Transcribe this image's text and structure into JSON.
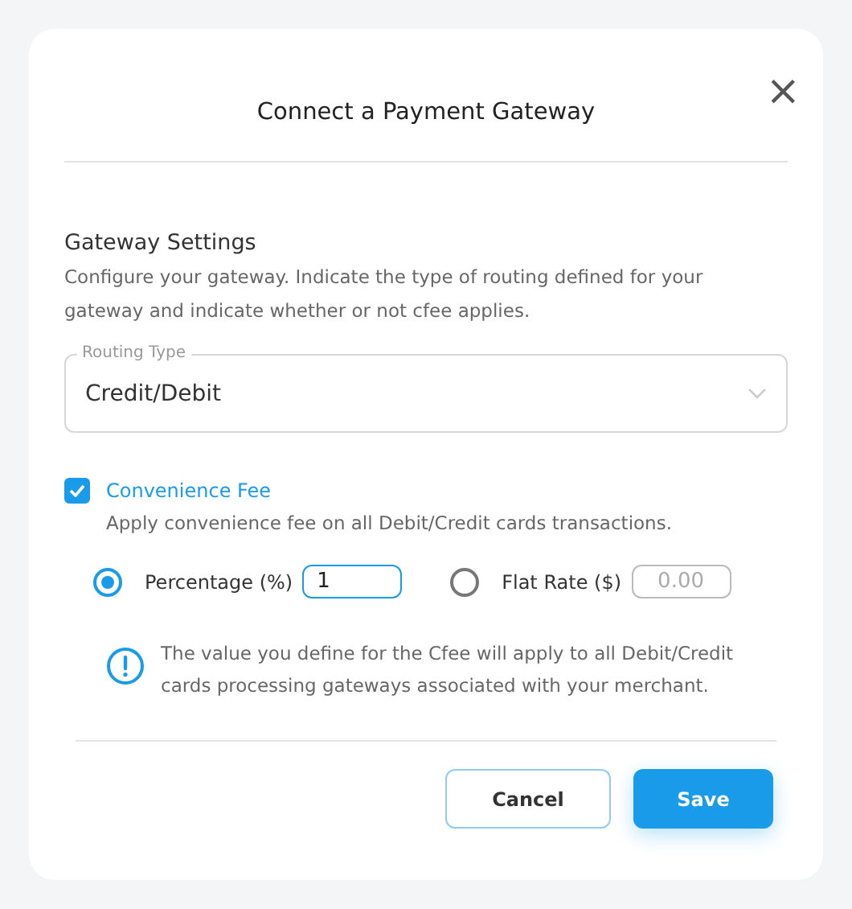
{
  "dialog": {
    "title": "Connect a Payment Gateway",
    "close": "×"
  },
  "section": {
    "heading": "Gateway Settings",
    "description": "Configure your gateway. Indicate the type of routing defined for your gateway and indicate whether or not cfee applies."
  },
  "routing_type": {
    "label": "Routing Type",
    "value": "Credit/Debit"
  },
  "convenience_fee": {
    "label": "Convenience Fee",
    "checked": true,
    "description": "Apply convenience fee on all Debit/Credit cards transactions."
  },
  "fee_options": [
    {
      "label": "Percentage (%)",
      "selected": true,
      "value": "1"
    },
    {
      "label": "Flat Rate ($)",
      "selected": false,
      "placeholder": "0.00"
    }
  ],
  "info": "The value you define for the Cfee will apply to all Debit/Credit cards processing gateways associated with your merchant.",
  "buttons": [
    {
      "label": "Cancel",
      "kind": "secondary"
    },
    {
      "label": "Save",
      "kind": "primary"
    }
  ]
}
